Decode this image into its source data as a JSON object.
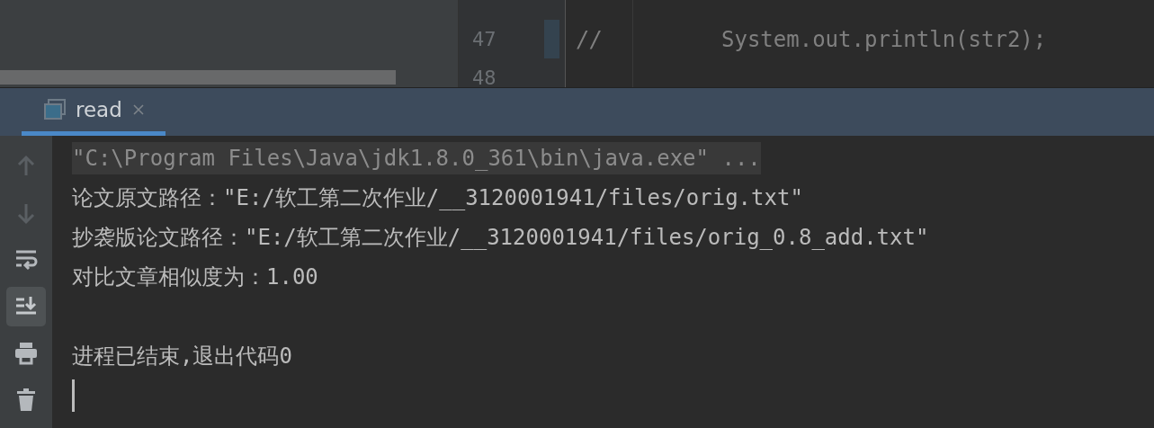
{
  "editor": {
    "lines": [
      {
        "number": "47",
        "comment": "//",
        "code": "System.out.println(str2);",
        "marked": true
      },
      {
        "number": "48",
        "marked": false
      }
    ]
  },
  "run_panel": {
    "tabs": [
      {
        "label": "read",
        "selected": true
      }
    ]
  },
  "toolbar": [
    {
      "kind": "up",
      "selected": false
    },
    {
      "kind": "down",
      "selected": false
    },
    {
      "kind": "wrap",
      "selected": false
    },
    {
      "kind": "scroll-end",
      "selected": true
    },
    {
      "kind": "print",
      "selected": false
    },
    {
      "kind": "clear",
      "selected": false
    }
  ],
  "console": {
    "lines": [
      {
        "kind": "command",
        "text": "\"C:\\Program Files\\Java\\jdk1.8.0_361\\bin\\java.exe\" ..."
      },
      {
        "kind": "output",
        "text": "论文原文路径：\"E:/软工第二次作业/__3120001941/files/orig.txt\""
      },
      {
        "kind": "output",
        "text": "抄袭版论文路径：\"E:/软工第二次作业/__3120001941/files/orig_0.8_add.txt\""
      },
      {
        "kind": "output",
        "text": "对比文章相似度为：1.00"
      },
      {
        "kind": "blank"
      },
      {
        "kind": "output",
        "text": "进程已结束,退出代码0"
      }
    ]
  }
}
